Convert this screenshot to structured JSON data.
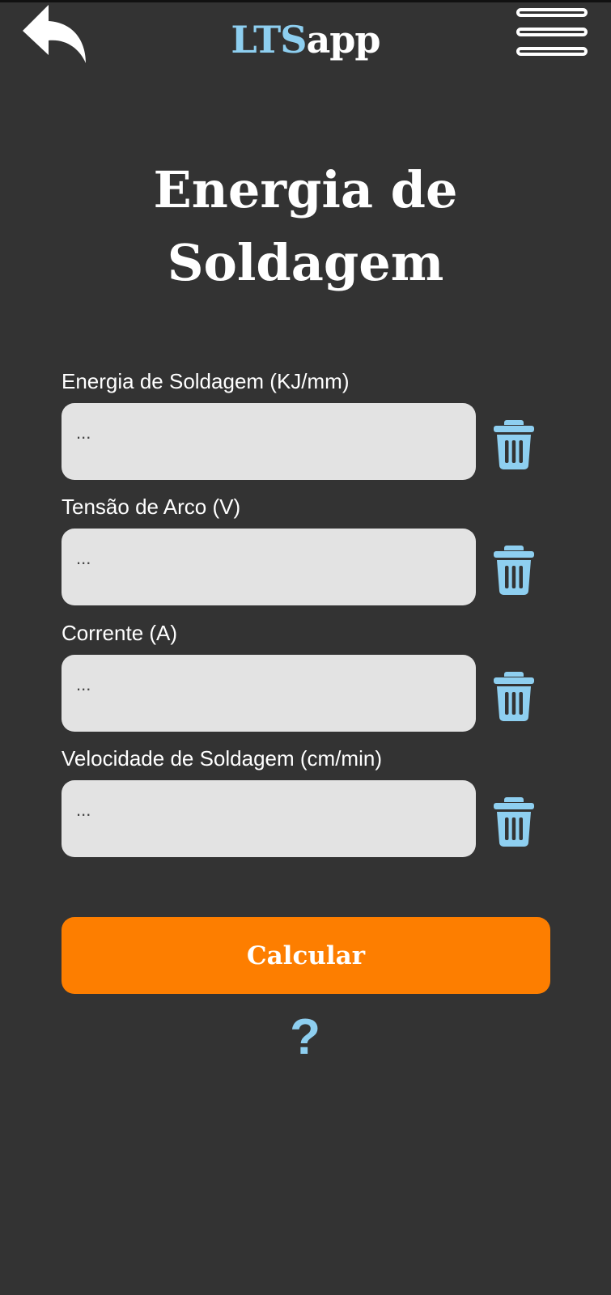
{
  "header": {
    "logo_part1": "LTS",
    "logo_part2": "app",
    "back_icon": "back-arrow-icon",
    "menu_icon": "hamburger-menu-icon"
  },
  "page": {
    "title_line1": "Energia de",
    "title_line2": "Soldagem"
  },
  "fields": [
    {
      "label": "Energia de Soldagem (KJ/mm)",
      "placeholder": "..."
    },
    {
      "label": "Tensão de Arco (V)",
      "placeholder": "..."
    },
    {
      "label": "Corrente (A)",
      "placeholder": "..."
    },
    {
      "label": "Velocidade de Soldagem (cm/min)",
      "placeholder": "..."
    }
  ],
  "actions": {
    "calculate_label": "Calcular",
    "help_label": "?"
  },
  "colors": {
    "background": "#333333",
    "accent_blue": "#8ecff0",
    "accent_orange": "#fd7e00",
    "input_bg": "#e3e3e3"
  }
}
